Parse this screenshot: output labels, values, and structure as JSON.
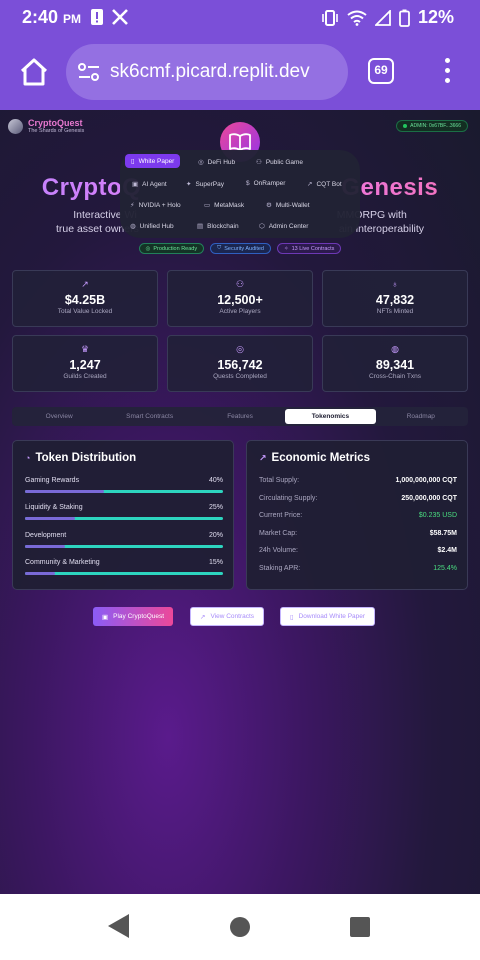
{
  "status_bar": {
    "time": "2:40",
    "ampm": "PM",
    "battery": "12%"
  },
  "browser": {
    "url": "sk6cmf.picard.replit.dev",
    "tab_count": "69"
  },
  "site": {
    "brand_title": "CryptoQuest",
    "brand_subtitle": "The Shards of Genesis",
    "admin_badge": "ADMIN: 0x67BF...3666",
    "hero_title_left": "CryptoQ",
    "hero_title_right": "Genesis",
    "hero_sub_line1_left": "Interactive Wi",
    "hero_sub_line1_right": "MMORPG with",
    "hero_sub_line2_left": "true asset owners",
    "hero_sub_line2_right": "ain interoperability",
    "badges": [
      "Production Ready",
      "Security Audited",
      "13 Live Contracts"
    ]
  },
  "nav_menu": {
    "row1": [
      "White Paper",
      "DeFi Hub",
      "Public Game"
    ],
    "row2": [
      "AI Agent",
      "SuperPay",
      "OnRamper",
      "CQT Bot"
    ],
    "row3": [
      "NVIDIA + Holo",
      "MetaMask",
      "Multi-Wallet"
    ],
    "row4": [
      "Unified Hub",
      "Blockchain",
      "Admin Center"
    ]
  },
  "stats": [
    {
      "value": "$4.25B",
      "label": "Total Value Locked",
      "icon": "trending-up-icon"
    },
    {
      "value": "12,500+",
      "label": "Active Players",
      "icon": "users-icon"
    },
    {
      "value": "47,832",
      "label": "NFTs Minted",
      "icon": "award-icon"
    },
    {
      "value": "1,247",
      "label": "Guilds Created",
      "icon": "crown-icon"
    },
    {
      "value": "156,742",
      "label": "Quests Completed",
      "icon": "target-icon"
    },
    {
      "value": "89,341",
      "label": "Cross-Chain Txns",
      "icon": "globe-icon"
    }
  ],
  "tabs": [
    "Overview",
    "Smart Contracts",
    "Features",
    "Tokenomics",
    "Roadmap"
  ],
  "token_distribution": {
    "title": "Token Distribution",
    "items": [
      {
        "label": "Gaming Rewards",
        "pct": "40%",
        "value": 40
      },
      {
        "label": "Liquidity & Staking",
        "pct": "25%",
        "value": 25
      },
      {
        "label": "Development",
        "pct": "20%",
        "value": 20
      },
      {
        "label": "Community & Marketing",
        "pct": "15%",
        "value": 15
      }
    ]
  },
  "economic_metrics": {
    "title": "Economic Metrics",
    "items": [
      {
        "key": "Total Supply:",
        "value": "1,000,000,000 CQT"
      },
      {
        "key": "Circulating Supply:",
        "value": "250,000,000 CQT"
      },
      {
        "key": "Current Price:",
        "value": "$0.235 USD"
      },
      {
        "key": "Market Cap:",
        "value": "$58.75M"
      },
      {
        "key": "24h Volume:",
        "value": "$2.4M"
      },
      {
        "key": "Staking APR:",
        "value": "125.4%"
      }
    ]
  },
  "cta": {
    "play": "Play CryptoQuest",
    "contracts": "View Contracts",
    "whitepaper": "Download White Paper"
  }
}
